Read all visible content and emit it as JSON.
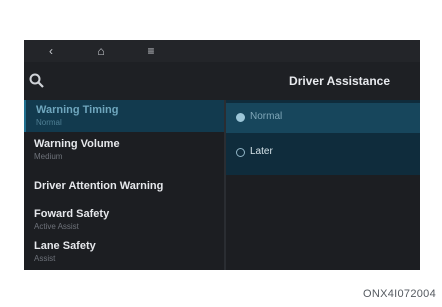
{
  "topbar": {
    "back_icon": "chevron-left-icon",
    "home_icon": "home-icon",
    "menu_icon": "menu-icon"
  },
  "header": {
    "search_icon": "search-icon",
    "title": "Driver Assistance"
  },
  "settings_list": [
    {
      "label": "Warning Timing",
      "sub": "Normal",
      "selected": true
    },
    {
      "label": "Warning Volume",
      "sub": "Medium",
      "selected": false
    },
    {
      "label": "Driver Attention Warning",
      "sub": "",
      "selected": false
    },
    {
      "label": "Foward Safety",
      "sub": "Active Assist",
      "selected": false
    },
    {
      "label": "Lane Safety",
      "sub": "Assist",
      "selected": false
    }
  ],
  "options": [
    {
      "label": "Normal",
      "checked": true
    },
    {
      "label": "Later",
      "checked": false
    }
  ],
  "caption": "ONX4I072004",
  "colors": {
    "selected_bg": "#123a4e",
    "panel_bg": "#0f2c3c",
    "screen_bg": "#1c1e22"
  }
}
